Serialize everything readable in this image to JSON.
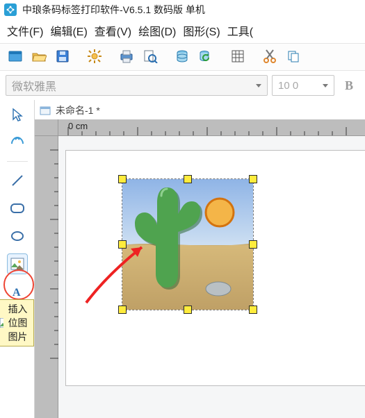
{
  "titlebar": {
    "title": "中琅条码标签打印软件-V6.5.1 数码版 单机"
  },
  "menubar": {
    "file": "文件(F)",
    "edit": "编辑(E)",
    "view": "查看(V)",
    "draw": "绘图(D)",
    "shape": "图形(S)",
    "tools": "工具("
  },
  "fontbar": {
    "font_name": "微软雅黑",
    "font_size": "10 0",
    "bold": "B"
  },
  "doc_tab": {
    "label": "未命名-1 *"
  },
  "ruler": {
    "zero_label": "0 cm"
  },
  "tooltip": {
    "text": "插入位图图片"
  }
}
